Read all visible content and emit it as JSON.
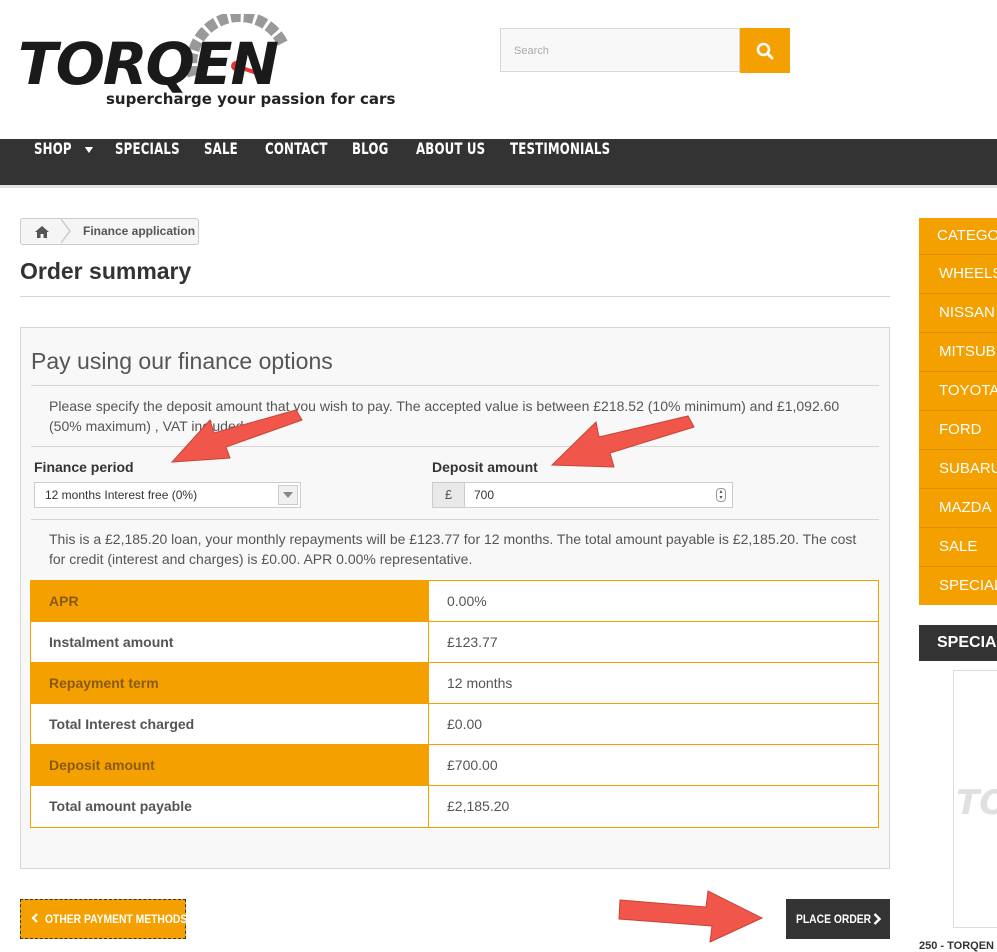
{
  "header": {
    "logo_text": "TORQEN",
    "tagline": "supercharge your passion for cars",
    "search_placeholder": "Search",
    "search_icon": "search-icon"
  },
  "nav": {
    "items": [
      "SHOP",
      "SPECIALS",
      "SALE",
      "CONTACT",
      "BLOG",
      "ABOUT US",
      "TESTIMONIALS"
    ]
  },
  "breadcrumb": {
    "home_icon": "home-icon",
    "current": "Finance application"
  },
  "page_title": "Order summary",
  "finance": {
    "title": "Pay using our finance options",
    "intro": "Please specify the deposit amount that you wish to pay. The accepted value is between £218.52 (10% minimum) and £1,092.60 (50% maximum) , VAT included",
    "period_label": "Finance period",
    "period_value": "12 months Interest free (0%)",
    "deposit_label": "Deposit amount",
    "currency": "£",
    "deposit_value": "700",
    "summary": "This is a £2,185.20 loan, your monthly repayments will be £123.77 for 12 months. The total amount payable is £2,185.20. The cost for credit (interest and charges) is £0.00. APR 0.00% representative.",
    "table": [
      {
        "label": "APR",
        "value": "0.00%"
      },
      {
        "label": "Instalment amount",
        "value": "£123.77"
      },
      {
        "label": "Repayment term",
        "value": "12 months"
      },
      {
        "label": "Total Interest charged",
        "value": "£0.00"
      },
      {
        "label": "Deposit amount",
        "value": "£700.00"
      },
      {
        "label": "Total amount payable",
        "value": "£2,185.20"
      }
    ]
  },
  "buttons": {
    "other_payment": "OTHER PAYMENT METHODS",
    "place_order": "PLACE ORDER"
  },
  "sidebar": {
    "categories_heading": "CATEGO",
    "categories": [
      "WHEELS",
      "NISSAN",
      "MITSUB",
      "TOYOTA",
      "FORD",
      "SUBARU",
      "MAZDA",
      "SALE",
      "SPECIAL"
    ],
    "specials_heading": "SPECIAL",
    "specials_logo": "TO",
    "specials_item_title": "250 - TORQEN"
  },
  "colors": {
    "accent": "#f4a000",
    "nav_bg": "#333333",
    "annotation_arrow": "#f0574a"
  }
}
